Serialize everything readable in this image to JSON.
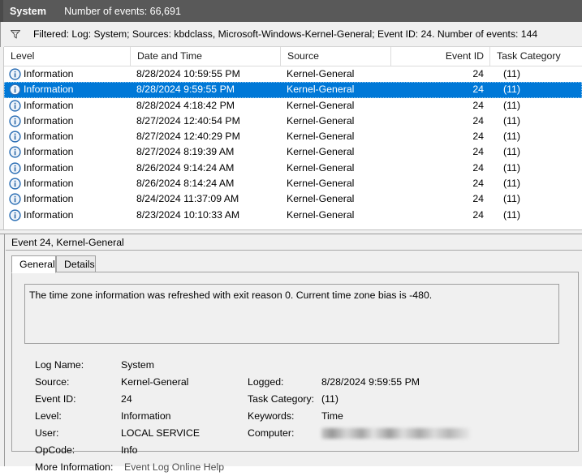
{
  "titlebar": {
    "log_name": "System",
    "event_count_label": "Number of events: 66,691"
  },
  "filterbar": {
    "icon": "funnel-icon",
    "text": "Filtered: Log: System; Sources: kbdclass, Microsoft-Windows-Kernel-General; Event ID: 24. Number of events: 144"
  },
  "listview": {
    "columns": [
      {
        "key": "level",
        "label": "Level"
      },
      {
        "key": "date",
        "label": "Date and Time"
      },
      {
        "key": "source",
        "label": "Source"
      },
      {
        "key": "event_id",
        "label": "Event ID"
      },
      {
        "key": "task_category",
        "label": "Task Category"
      }
    ],
    "rows": [
      {
        "level": "Information",
        "date": "8/28/2024 10:59:55 PM",
        "source": "Kernel-General",
        "event_id": "24",
        "task_category": "(11)",
        "selected": false
      },
      {
        "level": "Information",
        "date": "8/28/2024 9:59:55 PM",
        "source": "Kernel-General",
        "event_id": "24",
        "task_category": "(11)",
        "selected": true
      },
      {
        "level": "Information",
        "date": "8/28/2024 4:18:42 PM",
        "source": "Kernel-General",
        "event_id": "24",
        "task_category": "(11)",
        "selected": false
      },
      {
        "level": "Information",
        "date": "8/27/2024 12:40:54 PM",
        "source": "Kernel-General",
        "event_id": "24",
        "task_category": "(11)",
        "selected": false
      },
      {
        "level": "Information",
        "date": "8/27/2024 12:40:29 PM",
        "source": "Kernel-General",
        "event_id": "24",
        "task_category": "(11)",
        "selected": false
      },
      {
        "level": "Information",
        "date": "8/27/2024 8:19:39 AM",
        "source": "Kernel-General",
        "event_id": "24",
        "task_category": "(11)",
        "selected": false
      },
      {
        "level": "Information",
        "date": "8/26/2024 9:14:24 AM",
        "source": "Kernel-General",
        "event_id": "24",
        "task_category": "(11)",
        "selected": false
      },
      {
        "level": "Information",
        "date": "8/26/2024 8:14:24 AM",
        "source": "Kernel-General",
        "event_id": "24",
        "task_category": "(11)",
        "selected": false
      },
      {
        "level": "Information",
        "date": "8/24/2024 11:37:09 AM",
        "source": "Kernel-General",
        "event_id": "24",
        "task_category": "(11)",
        "selected": false
      },
      {
        "level": "Information",
        "date": "8/23/2024 10:10:33 AM",
        "source": "Kernel-General",
        "event_id": "24",
        "task_category": "(11)",
        "selected": false
      }
    ]
  },
  "detail": {
    "header": "Event 24, Kernel-General",
    "tabs": [
      {
        "key": "general",
        "label": "General",
        "active": true
      },
      {
        "key": "details",
        "label": "Details",
        "active": false
      }
    ],
    "message": "The time zone information was refreshed with exit reason 0. Current time zone bias is -480.",
    "fields": {
      "log_name_label": "Log Name:",
      "log_name_value": "System",
      "source_label": "Source:",
      "source_value": "Kernel-General",
      "logged_label": "Logged:",
      "logged_value": "8/28/2024 9:59:55 PM",
      "event_id_label": "Event ID:",
      "event_id_value": "24",
      "task_category_label": "Task Category:",
      "task_category_value": "(11)",
      "level_label": "Level:",
      "level_value": "Information",
      "keywords_label": "Keywords:",
      "keywords_value": "Time",
      "user_label": "User:",
      "user_value": "LOCAL SERVICE",
      "computer_label": "Computer:",
      "computer_value": "",
      "opcode_label": "OpCode:",
      "opcode_value": "Info",
      "more_information_label": "More Information:",
      "more_information_link": "Event Log Online Help"
    }
  },
  "colors": {
    "titlebar_bg": "#595959",
    "selection_blue": "#0078d7",
    "pane_bg": "#f0f0f0",
    "list_bg": "#ffffff"
  }
}
